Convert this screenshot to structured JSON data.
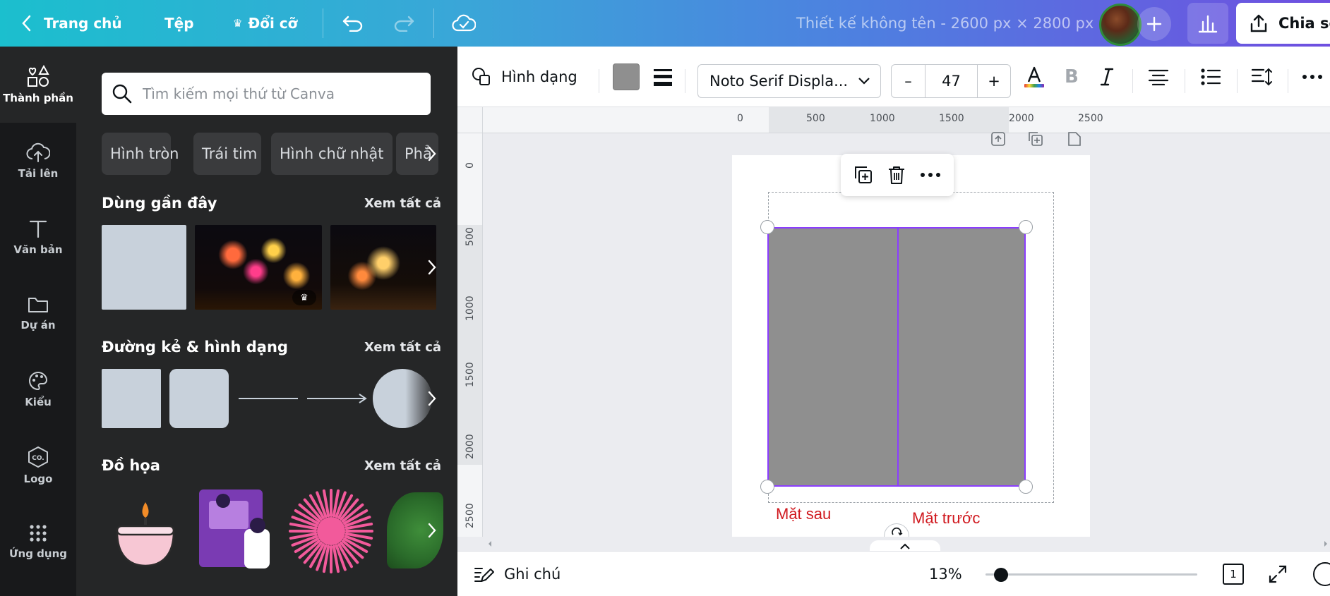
{
  "topbar": {
    "home_label": "Trang chủ",
    "file_label": "Tệp",
    "resize_label": "Đổi cỡ",
    "doc_title": "Thiết kế không tên - 2600 px × 2800 px",
    "share_label": "Chia sẻ"
  },
  "rail": {
    "items": [
      {
        "label": "Thành phần",
        "icon": "elements-icon"
      },
      {
        "label": "Tải lên",
        "icon": "upload-cloud-icon"
      },
      {
        "label": "Văn bản",
        "icon": "text-icon"
      },
      {
        "label": "Dự án",
        "icon": "folder-icon"
      },
      {
        "label": "Kiểu",
        "icon": "palette-icon"
      },
      {
        "label": "Logo",
        "icon": "logo-icon"
      },
      {
        "label": "Ứng dụng",
        "icon": "apps-grid-icon"
      }
    ]
  },
  "panel": {
    "search_placeholder": "Tìm kiếm mọi thứ từ Canva",
    "chips": [
      "Hình tròn",
      "Trái tim",
      "Hình chữ nhật",
      "Phẳ"
    ],
    "see_all": "Xem tất cả",
    "sections": {
      "recent": "Dùng gần đây",
      "shapes": "Đường kẻ & hình dạng",
      "graphics": "Đồ họa"
    }
  },
  "toolbar": {
    "shape_label": "Hình dạng",
    "fill_color": "#8f8f8f",
    "font_name": "Noto Serif Displa...",
    "font_size": "47",
    "minus": "–",
    "plus": "+"
  },
  "rulers": {
    "h_labels": [
      "0",
      "500",
      "1000",
      "1500",
      "2000",
      "2500"
    ],
    "v_labels": [
      "0",
      "500",
      "1000",
      "1500",
      "2000",
      "2500"
    ]
  },
  "canvas": {
    "label_back": "Mặt sau",
    "label_front": "Mặt trước",
    "accent": "#8b3dff",
    "label_color": "#d0191f"
  },
  "bottombar": {
    "notes_label": "Ghi chú",
    "zoom": "13%",
    "page_num": "1"
  }
}
